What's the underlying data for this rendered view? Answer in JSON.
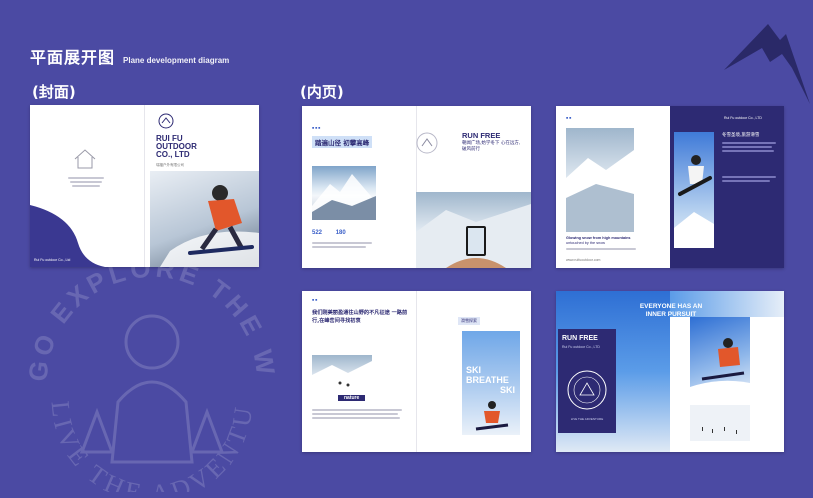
{
  "header": {
    "title_cn": "平面展开图",
    "title_en": "Plane development diagram"
  },
  "sections": {
    "cover_label": "(封面)",
    "inner_label": "(内页)"
  },
  "cover": {
    "brand_line1": "RUI FU",
    "brand_line2": "OUTDOOR",
    "brand_line3": "CO., LTD",
    "brand_cn": "瑞福户外有限公司",
    "footer": "Rui Fu outdoor Co., Ltd"
  },
  "spread1": {
    "header_cn": "踏遍山径 初攀高峰",
    "run_free": "RUN FREE",
    "run_free_sub": "朝闻广场,始学冬下 心在远方,破风前行",
    "stat1": "522",
    "stat2": "180"
  },
  "spread2": {
    "caption_title": "Glowing snow from high mountains",
    "caption_sub": "untouched by the snow",
    "company": "Rui Fu outdoor Co., LTD",
    "body_heading": "冬雪圣境,旅游滑雪",
    "footer": "www.ruifuoutdoor.com"
  },
  "spread3": {
    "heading_cn": "我们刚美丽盈通往山野的不凡征途 一路前行,在峰峦间寻找初衷",
    "tag": "滑雪探索",
    "nature": "nature",
    "ski_word1": "SKI",
    "ski_word2": "BREATHE",
    "ski_word3": "SKI"
  },
  "spread4": {
    "headline1": "EVERYONE HAS AN",
    "headline2": "INNER PURSUIT",
    "run_free": "RUN FREE",
    "run_free_sub": "Rui Fu outdoor Co., LTD",
    "badge_text": "LIVE THE ADVENTURE"
  },
  "watermark": {
    "top": "GO EXPLORE THE WORLD",
    "bottom": "LIVE THE ADVENTURE"
  },
  "colors": {
    "background": "#4b4aa3",
    "navy": "#2d2a73",
    "accent_blue": "#3a5fc8",
    "accent_orange": "#e2572b"
  }
}
